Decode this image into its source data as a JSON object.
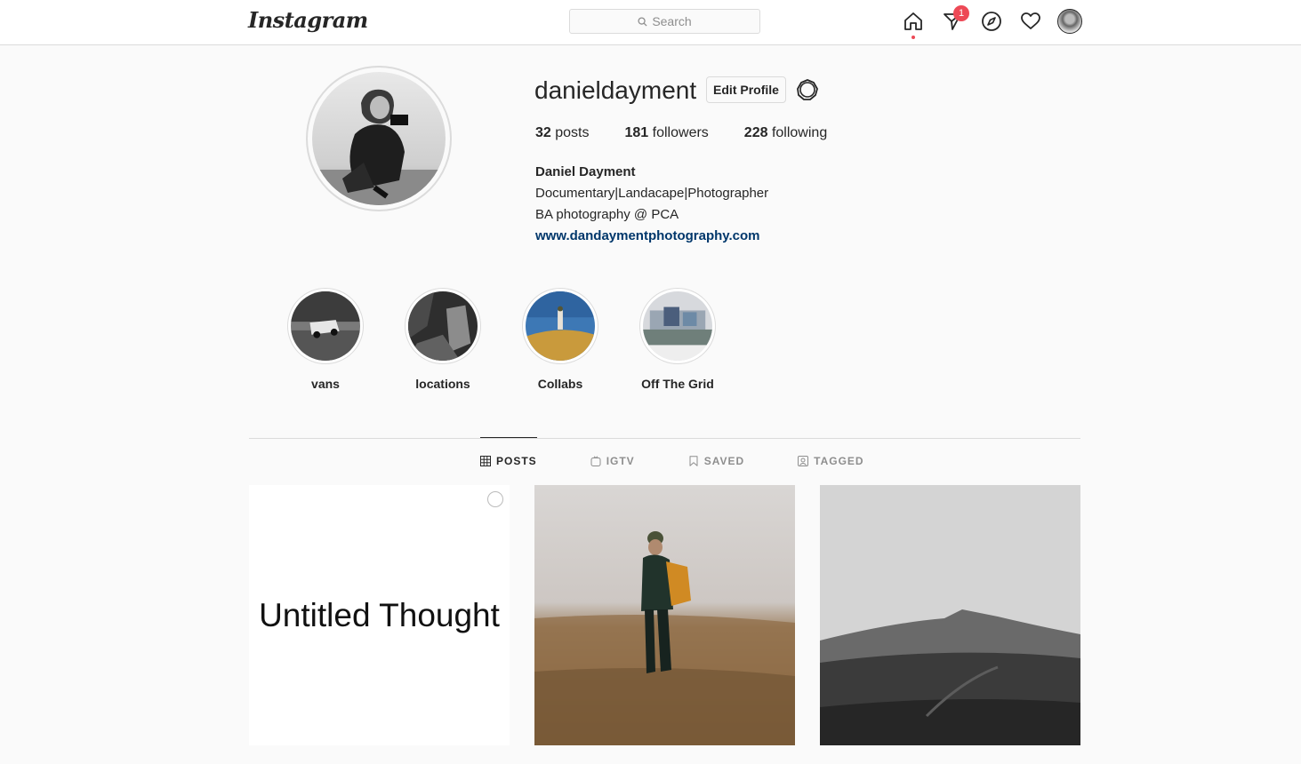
{
  "nav": {
    "logo": "Instagram",
    "search_placeholder": "Search",
    "notification_count": "1",
    "icons": [
      "home-icon",
      "direct-icon",
      "explore-icon",
      "heart-icon",
      "profile-avatar"
    ]
  },
  "profile": {
    "username": "danieldayment",
    "edit_label": "Edit Profile",
    "stats": {
      "posts_count": "32",
      "posts_label": "posts",
      "followers_count": "181",
      "followers_label": "followers",
      "following_count": "228",
      "following_label": "following"
    },
    "full_name": "Daniel Dayment",
    "bio_line1": "Documentary|Landacape|Photographer",
    "bio_line2": "BA photography @ PCA",
    "website": "www.dandaymentphotography.com"
  },
  "highlights": [
    {
      "label": "vans"
    },
    {
      "label": "locations"
    },
    {
      "label": "Collabs"
    },
    {
      "label": "Off The Grid"
    }
  ],
  "tabs": [
    {
      "label": "POSTS",
      "active": true
    },
    {
      "label": "IGTV",
      "active": false
    },
    {
      "label": "SAVED",
      "active": false
    },
    {
      "label": "TAGGED",
      "active": false
    }
  ],
  "posts": [
    {
      "text": "Untitled Thought"
    }
  ],
  "colors": {
    "accent_red": "#ed4956",
    "link": "#00376b",
    "border": "#dbdbdb",
    "background": "#fafafa"
  }
}
